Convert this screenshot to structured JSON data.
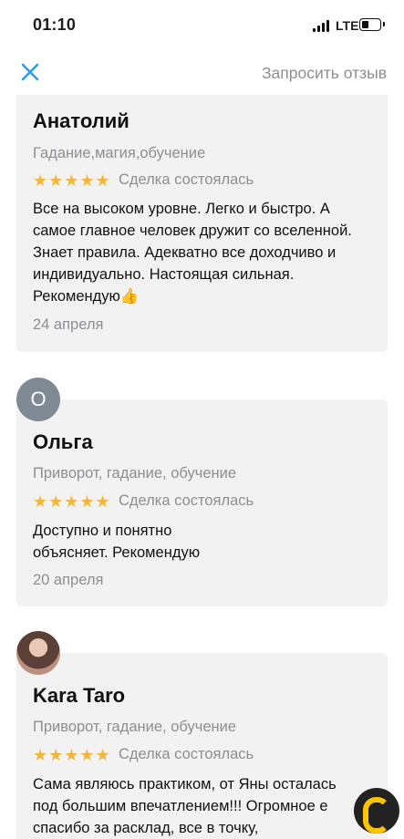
{
  "status_bar": {
    "time": "01:10",
    "network": "LTE",
    "battery_level": 0.3
  },
  "nav": {
    "close_icon": "close-icon",
    "request_review": "Запросить отзыв"
  },
  "reviews": [
    {
      "name": "Анатолий",
      "services": "Гадание,магия,обучение",
      "rating": 5,
      "deal_status": "Сделка состоялась",
      "text": "Все на высоком уровне. Легко и быстро. А самое главное человек дружит со вселенной. Знает правила. Адекватно все доходчиво и индивидуально. Настоящая сильная. Рекомендую👍",
      "date": "24 апреля"
    },
    {
      "avatar_letter": "О",
      "name": "Ольга",
      "services": "Приворот, гадание, обучение",
      "rating": 5,
      "deal_status": "Сделка состоялась",
      "text_line1": "Доступно и понятно",
      "text_line2": "объясняет. Рекомендую",
      "date": "20 апреля"
    },
    {
      "name": "Kara Taro",
      "services": "Приворот, гадание, обучение",
      "rating": 5,
      "deal_status": "Сделка состоялась",
      "text_line1": "Сама являюсь практиком, от Яны осталась",
      "text_line2": "под большим впечатлением!!! Огромное е",
      "text_line3": "спасибо за расклад, все в точку,"
    }
  ],
  "colors": {
    "star": "#f4b63a",
    "accent": "#2f9ee8",
    "card_bg": "#f2f2f2",
    "muted": "#8e8e93",
    "fab_yellow": "#ffc400"
  }
}
